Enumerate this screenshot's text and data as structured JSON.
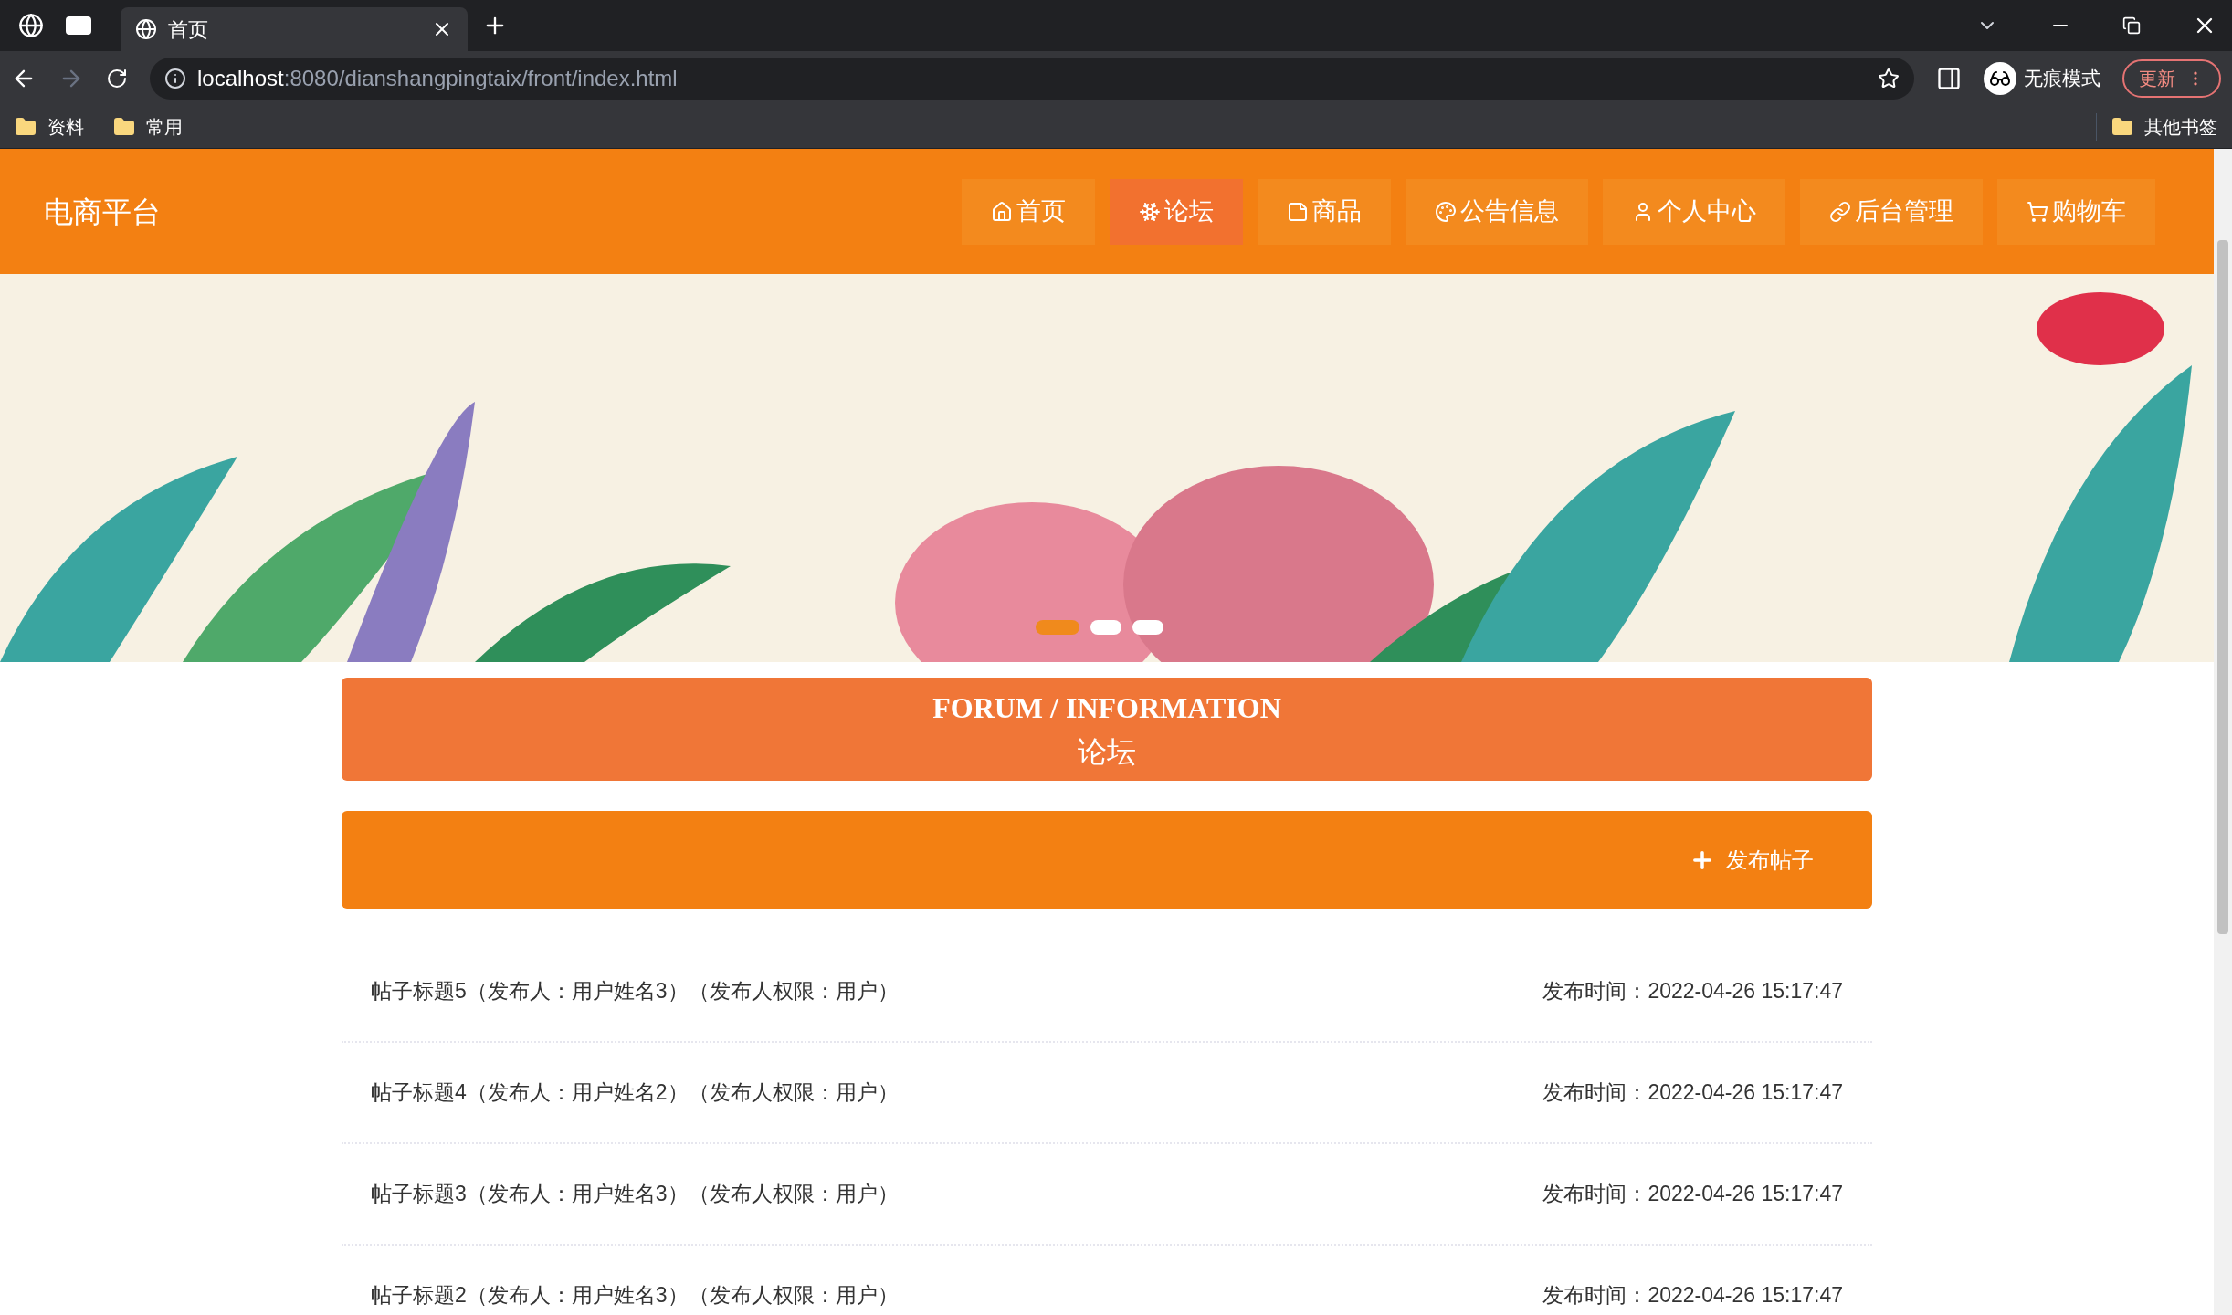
{
  "browser": {
    "tabs": [
      {
        "title": "首页",
        "selected": true
      }
    ],
    "address": {
      "host": "localhost",
      "path": ":8080/dianshangpingtaix/front/index.html"
    },
    "profile": "无痕模式",
    "update": "更新",
    "bookmarks": [
      "资料",
      "常用"
    ],
    "other_bookmarks": "其他书签"
  },
  "site": {
    "logo": "电商平台",
    "nav": [
      {
        "label": "首页",
        "kind": "home",
        "selected": false
      },
      {
        "label": "论坛",
        "kind": "snow",
        "selected": true
      },
      {
        "label": "商品",
        "kind": "note",
        "selected": false
      },
      {
        "label": "公告信息",
        "kind": "palette",
        "selected": false
      },
      {
        "label": "个人中心",
        "kind": "user",
        "selected": false
      },
      {
        "label": "后台管理",
        "kind": "link",
        "selected": false
      },
      {
        "label": "购物车",
        "kind": "cart",
        "selected": false
      }
    ]
  },
  "carousel": {
    "dots": [
      {
        "selected": true
      },
      {
        "selected": false
      },
      {
        "selected": false
      }
    ]
  },
  "section": {
    "title_en": "FORUM / INFORMATION",
    "title_cn": "论坛"
  },
  "action": "发布帖子",
  "posts": [
    {
      "title": "帖子标题5（发布人：用户姓名3）（发布人权限：用户）",
      "time": "发布时间：2022-04-26 15:17:47"
    },
    {
      "title": "帖子标题4（发布人：用户姓名2）（发布人权限：用户）",
      "time": "发布时间：2022-04-26 15:17:47"
    },
    {
      "title": "帖子标题3（发布人：用户姓名3）（发布人权限：用户）",
      "time": "发布时间：2022-04-26 15:17:47"
    },
    {
      "title": "帖子标题2（发布人：用户姓名3）（发布人权限：用户）",
      "time": "发布时间：2022-04-26 15:17:47"
    }
  ]
}
